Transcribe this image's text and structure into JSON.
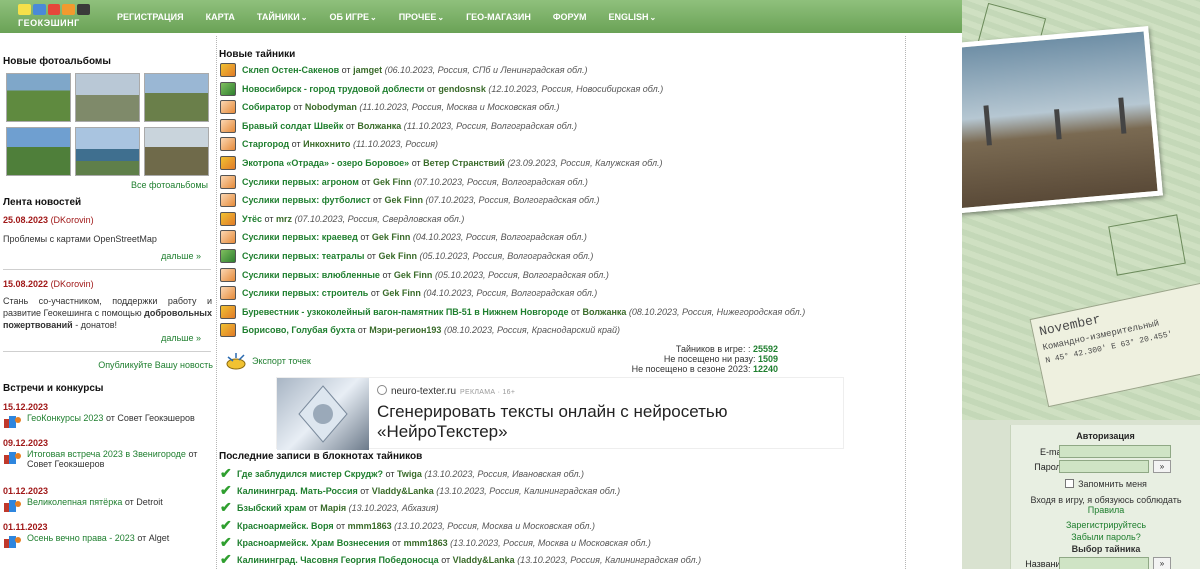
{
  "header": {
    "logo_text": "ГЕОКЭШИНГ",
    "nav": [
      {
        "label": "РЕГИСТРАЦИЯ",
        "caret": ""
      },
      {
        "label": "КАРТА",
        "caret": ""
      },
      {
        "label": "ТАЙНИКИ",
        "caret": "⌄"
      },
      {
        "label": "ОБ ИГРЕ",
        "caret": "⌄"
      },
      {
        "label": "ПРОЧЕЕ",
        "caret": "⌄"
      },
      {
        "label": "ГЕО-МАГАЗИН",
        "caret": ""
      },
      {
        "label": "ФОРУМ",
        "caret": ""
      },
      {
        "label": "ENGLISH",
        "caret": "⌄"
      }
    ]
  },
  "sidebar": {
    "albums_title": "Новые фотоальбомы",
    "all_albums": "Все фотоальбомы",
    "news_title": "Лента новостей",
    "news": [
      {
        "date": "25.08.2023",
        "author": "(DKorovin)",
        "text": "Проблемы с картами OpenStreetMap",
        "more": "дальше »"
      },
      {
        "date": "15.08.2022",
        "author": "(DKorovin)",
        "text_before": "Стань со-участником, поддержки работу и развитие Геокешинга с помощью ",
        "text_bold": "добровольных пожертвований",
        "text_after": " - донатов!",
        "more": "дальше »"
      }
    ],
    "publish_news": "Опубликуйте Вашу новость",
    "events_title": "Встречи и конкурсы",
    "events": [
      {
        "date": "15.12.2023",
        "name": "ГеоКонкурсы 2023",
        "by": "от Совет Геокэшеров"
      },
      {
        "date": "09.12.2023",
        "name": "Итоговая встреча 2023 в Звенигороде",
        "by": "от Совет Геокэшеров"
      },
      {
        "date": "01.12.2023",
        "name": "Великолепная пятёрка",
        "by": "от Detroit"
      },
      {
        "date": "01.11.2023",
        "name": "Осень вечно права - 2023",
        "by": "от Alget"
      }
    ]
  },
  "main": {
    "new_caches_title": "Новые тайники",
    "caches": [
      {
        "name": "Склеп Остен-Сакенов",
        "by": "от",
        "author": "jamget",
        "meta": "(06.10.2023, Россия, СПб и Ленинградская обл.)",
        "icon": "i1"
      },
      {
        "name": "Новосибирск - город трудовой доблести",
        "by": "от",
        "author": "gendosnsk",
        "meta": "(12.10.2023, Россия, Новосибирская обл.)",
        "icon": "i3"
      },
      {
        "name": "Собиратор",
        "by": "от",
        "author": "Nobodyman",
        "meta": "(11.10.2023, Россия, Москва и Московская обл.)",
        "icon": "i2"
      },
      {
        "name": "Бравый солдат Швейк",
        "by": "от",
        "author": "Волжанка",
        "meta": "(11.10.2023, Россия, Волгоградская обл.)",
        "icon": "i2"
      },
      {
        "name": "Старгород",
        "by": "от",
        "author": "Инкохнито",
        "meta": "(11.10.2023, Россия)",
        "icon": "i2"
      },
      {
        "name": "Экотропа «Отрада» - озеро Боровое»",
        "by": "от",
        "author": "Ветер Странствий",
        "meta": "(23.09.2023, Россия, Калужская обл.)",
        "icon": "i1"
      },
      {
        "name": "Суслики первых: агроном",
        "by": "от",
        "author": "Gek Finn",
        "meta": "(07.10.2023, Россия, Волгоградская обл.)",
        "icon": "i2"
      },
      {
        "name": "Суслики первых: футболист",
        "by": "от",
        "author": "Gek Finn",
        "meta": "(07.10.2023, Россия, Волгоградская обл.)",
        "icon": "i2"
      },
      {
        "name": "Утёс",
        "by": "от",
        "author": "mrz",
        "meta": "(07.10.2023, Россия, Свердловская обл.)",
        "icon": "i1"
      },
      {
        "name": "Суслики первых: краевед",
        "by": "от",
        "author": "Gek Finn",
        "meta": "(04.10.2023, Россия, Волгоградская обл.)",
        "icon": "i2"
      },
      {
        "name": "Суслики первых: театралы",
        "by": "от",
        "author": "Gek Finn",
        "meta": "(05.10.2023, Россия, Волгоградская обл.)",
        "icon": "i3"
      },
      {
        "name": "Суслики первых: влюбленные",
        "by": "от",
        "author": "Gek Finn",
        "meta": "(05.10.2023, Россия, Волгоградская обл.)",
        "icon": "i2"
      },
      {
        "name": "Суслики первых: строитель",
        "by": "от",
        "author": "Gek Finn",
        "meta": "(04.10.2023, Россия, Волгоградская обл.)",
        "icon": "i2"
      },
      {
        "name": "Буревестник - узкоколейный вагон-памятник ПВ-51 в Нижнем Новгороде",
        "by": "от",
        "author": "Волжанка",
        "meta": "(08.10.2023, Россия, Нижегородская обл.)",
        "icon": "i1"
      },
      {
        "name": "Борисово, Голубая бухта",
        "by": "от",
        "author": "Мэри-регион193",
        "meta": "(08.10.2023, Россия, Краснодарский край)",
        "icon": "i1"
      }
    ],
    "export_label": "Экспорт точек",
    "stats": [
      {
        "label": "Тайников в игре: :",
        "value": "25592"
      },
      {
        "label": "Не посещено ни разу:",
        "value": "1509"
      },
      {
        "label": "Не посещено в сезоне 2023:",
        "value": "12240"
      }
    ],
    "ad": {
      "site": "neuro-texter.ru",
      "tag": "РЕКЛАМА · 16+",
      "title": "Сгенерировать тексты онлайн с нейросетью «НейроТекстер»"
    },
    "logs_title": "Последние записи в блокнотах тайников",
    "logs": [
      {
        "name": "Где заблудился мистер Скрудж?",
        "by": "от",
        "author": "Twiga",
        "meta": "(13.10.2023, Россия, Ивановская обл.)"
      },
      {
        "name": "Калининград. Мать-Россия",
        "by": "от",
        "author": "Vladdy&Lanka",
        "meta": "(13.10.2023, Россия, Калининградская обл.)"
      },
      {
        "name": "Бзыбский храм",
        "by": "от",
        "author": "Марiя",
        "meta": "(13.10.2023, Абхазия)"
      },
      {
        "name": "Красноармейск. Воря",
        "by": "от",
        "author": "mmm1863",
        "meta": "(13.10.2023, Россия, Москва и Московская обл.)"
      },
      {
        "name": "Красноармейск. Храм Вознесения",
        "by": "от",
        "author": "mmm1863",
        "meta": "(13.10.2023, Россия, Москва и Московская обл.)"
      },
      {
        "name": "Калининград. Часовня Георгия Победоносца",
        "by": "от",
        "author": "Vladdy&Lanka",
        "meta": "(13.10.2023, Россия, Калининградская обл.)"
      }
    ]
  },
  "decor": {
    "caption_line1": "November",
    "caption_line2": "Командно-измерительный",
    "caption_line3": "N 45° 42.300' E 63° 20.455'"
  },
  "auth": {
    "title": "Авторизация",
    "email_label": "E-mail:",
    "password_label": "Пароль:",
    "go": "»",
    "remember": "Запомнить меня",
    "agree_text": "Входя в игру, я обязуюсь соблюдать",
    "rules_link": "Правила",
    "register_link": "Зарегистрируйтесь",
    "forgot_link": "Забыли пароль?",
    "cache_search_title": "Выбор тайника",
    "name_label": "Название:"
  },
  "colors": {
    "nav_green": "#6aa256",
    "link_green": "#1f7f2f",
    "date_red": "#a01818"
  }
}
